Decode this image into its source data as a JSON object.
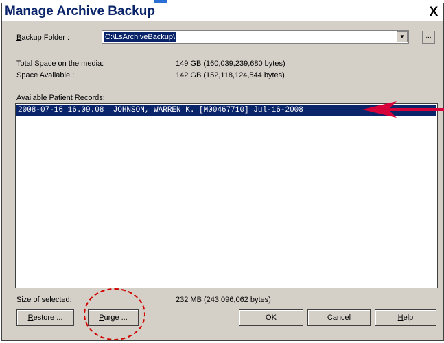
{
  "window": {
    "title": "Manage Archive Backup",
    "close_glyph": "X"
  },
  "backup_folder": {
    "label": "Backup Folder :",
    "value": "C:\\LsArchiveBackup\\",
    "browse_label": "..."
  },
  "media": {
    "total_label": "Total Space on the media:",
    "total_value": "149 GB (160,039,239,680 bytes)",
    "available_label": "Space Available :",
    "available_value": "142 GB (152,118,124,544 bytes)"
  },
  "records": {
    "label": "Available Patient Records:",
    "items": [
      "2008-07-16 16.09.08  JOHNSON, WARREN K. [M00467710] Jul-16-2008"
    ]
  },
  "selection": {
    "label": "Size of selected:",
    "value": "232 MB (243,096,062 bytes)"
  },
  "buttons": {
    "restore": "Restore ...",
    "purge": "Purge ...",
    "ok": "OK",
    "cancel": "Cancel",
    "help": "Help"
  },
  "annotations": {
    "arrow_color": "#d6003a",
    "circle_color": "#d00000"
  }
}
